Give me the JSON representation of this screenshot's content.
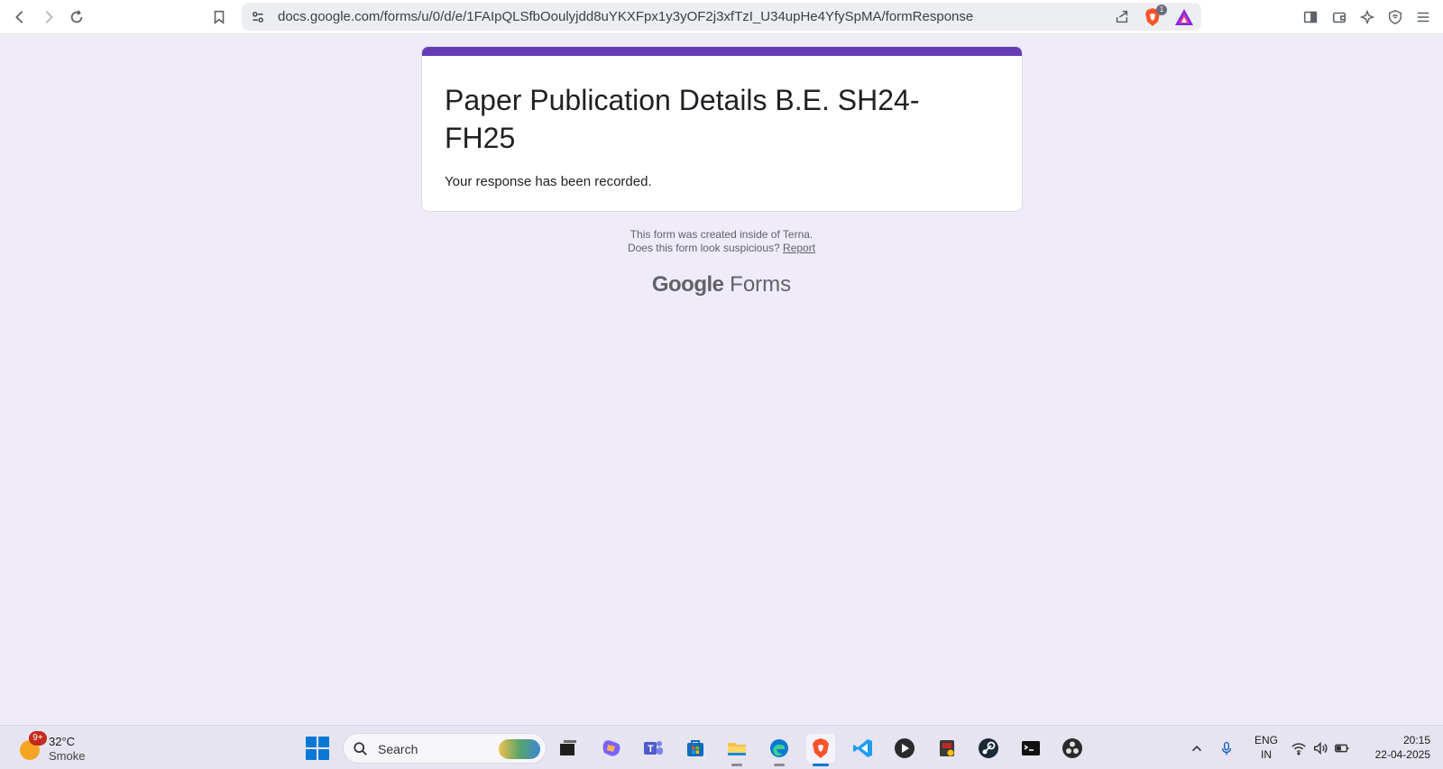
{
  "browser": {
    "url": "docs.google.com/forms/u/0/d/e/1FAIpQLSfbOoulyjdd8uYKXFpx1y3yOF2j3xfTzI_U34upHe4YfySpMA/formResponse",
    "brave_badge_count": "1",
    "icons": [
      "back-icon",
      "forward-icon",
      "reload-icon",
      "bookmark-icon",
      "site-settings-icon",
      "share-icon",
      "brave-shields-icon",
      "brave-rewards-icon",
      "sidebar-icon",
      "wallet-icon",
      "leo-ai-icon",
      "vpn-icon",
      "menu-icon"
    ]
  },
  "form": {
    "accent_color": "#673ab7",
    "title": "Paper Publication Details B.E. SH24-FH25",
    "confirmation": "Your response has been recorded.",
    "created_note": "This form was created inside of Terna.",
    "suspicious_prefix": "Does this form look suspicious?",
    "report_label": "Report",
    "branding_google": "Google",
    "branding_forms": "Forms"
  },
  "taskbar": {
    "weather": {
      "temp": "32°C",
      "condition": "Smoke",
      "badge": "9+"
    },
    "search_label": "Search",
    "language": {
      "line1": "ENG",
      "line2": "IN"
    },
    "clock": {
      "time": "20:15",
      "date": "22-04-2025"
    },
    "apps": [
      "start-icon",
      "search-icon",
      "task-view-icon",
      "copilot-icon",
      "teams-icon",
      "store-icon",
      "file-explorer-icon",
      "edge-icon",
      "brave-icon",
      "vscode-icon",
      "media-player-icon",
      "app-icon",
      "steam-icon",
      "terminal-icon",
      "obs-icon"
    ]
  }
}
